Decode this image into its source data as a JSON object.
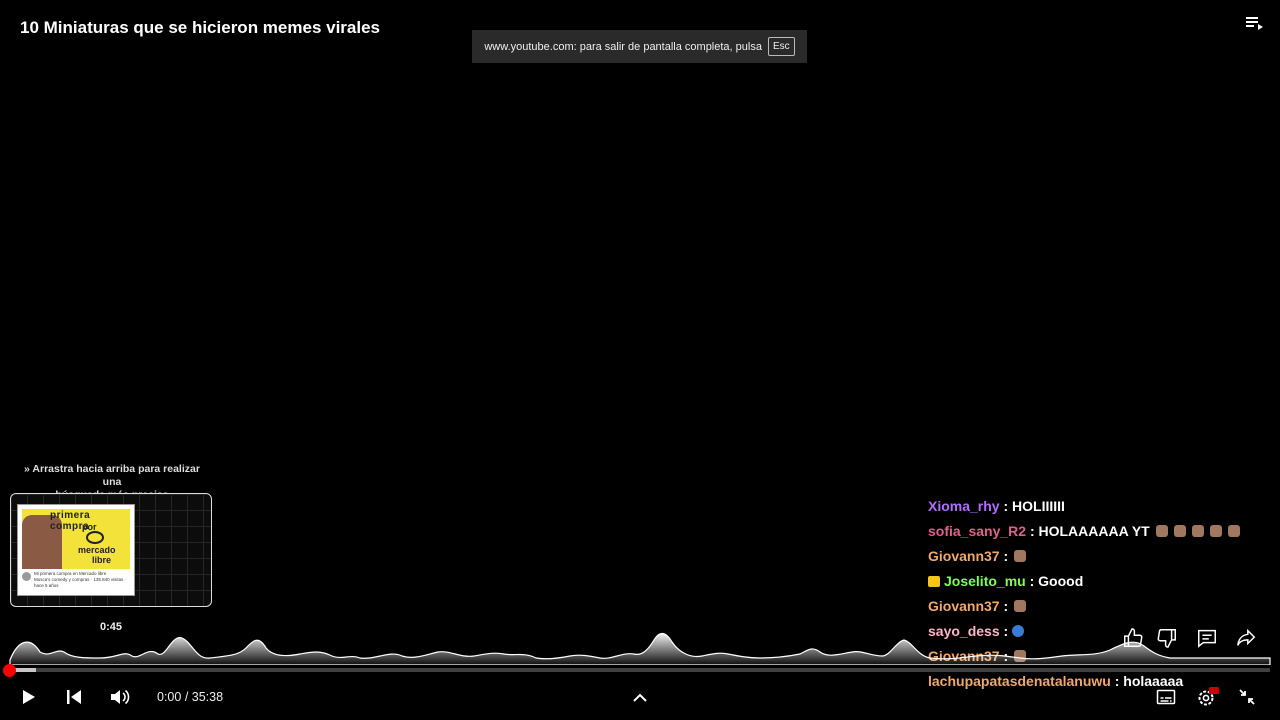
{
  "video": {
    "title": "10 Miniaturas que se hicieron memes virales"
  },
  "fullscreen_toast": {
    "text": "www.youtube.com: para salir de pantalla completa, pulsa",
    "key": "Esc"
  },
  "seek_preview": {
    "drag_hint_line1": "Arrastra hacia arriba para realizar una",
    "drag_hint_line2": "búsqueda más precisa",
    "time": "0:45",
    "thumb_text_1": "primera compra",
    "thumb_text_2": "por",
    "thumb_text_3": "mercado",
    "thumb_text_4": "libre",
    "thumb_meta_title": "Mi primera compra en Mercado libre",
    "thumb_meta_sub": "Mosca's comedy y compras · 135.840 visitas · hace 5 años"
  },
  "chat": [
    {
      "user": "Xioma_rhy",
      "color": "#b26cff",
      "text": ": HOLIIIIII",
      "emotes": 0,
      "badge": ""
    },
    {
      "user": "sofia_sany_R2",
      "color": "#e0608e",
      "text": ": HOLAAAAAA YT",
      "emotes": 5,
      "badge": ""
    },
    {
      "user": "Giovann37",
      "color": "#f2a86b",
      "text": ":",
      "emotes": 1,
      "badge": ""
    },
    {
      "user": "Joselito_mu",
      "color": "#7cff4f",
      "text": ": Goood",
      "emotes": 0,
      "badge": "crown"
    },
    {
      "user": "Giovann37",
      "color": "#f2a86b",
      "text": ":",
      "emotes": 1,
      "badge": ""
    },
    {
      "user": "sayo_dess",
      "color": "#ffb3c8",
      "text": ":",
      "emotes": 0,
      "badge": "globe"
    },
    {
      "user": "Giovann37",
      "color": "#f2a86b",
      "text": ":",
      "emotes": 1,
      "badge": ""
    },
    {
      "user": "lachupapatasdenatalanuwu",
      "color": "#f2a86b",
      "text": ": holaaaaa",
      "emotes": 0,
      "badge": ""
    }
  ],
  "player": {
    "current_time": "0:00",
    "separator": " / ",
    "duration": "35:38",
    "played_fraction": 0.0,
    "hover_fraction": 0.021
  },
  "icons": {
    "play": "play-icon",
    "previous": "previous-icon",
    "volume": "volume-icon",
    "expand": "chevron-up-icon",
    "subtitles": "subtitles-icon",
    "settings": "settings-icon",
    "exit_fullscreen": "exit-fullscreen-icon",
    "like": "thumbs-up-icon",
    "dislike": "thumbs-down-icon",
    "comments": "comments-icon",
    "share": "share-icon",
    "playlist": "playlist-icon"
  },
  "colors": {
    "accent": "#ff0000",
    "badge_hd": "#cc0000"
  }
}
